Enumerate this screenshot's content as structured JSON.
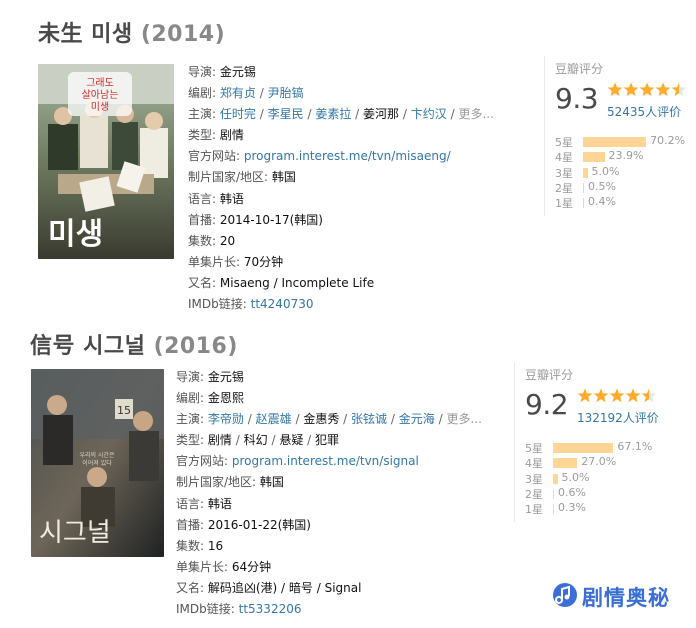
{
  "entries": [
    {
      "title": "未生 미생",
      "year": "(2014)",
      "poster": {
        "title_text": "미생",
        "tagline": "그래도 살아남는 미생"
      },
      "info": {
        "director_label": "导演:",
        "director": "金元锡",
        "writer_label": "编剧:",
        "writers": [
          "郑有贞",
          "尹胎镐"
        ],
        "cast_label": "主演:",
        "cast": [
          "任时完",
          "李星民",
          "姜素拉",
          "姜河那",
          "卞约汉"
        ],
        "cast_more": "更多...",
        "genre_label": "类型:",
        "genres": [
          "剧情"
        ],
        "website_label": "官方网站:",
        "website": "program.interest.me/tvn/misaeng/",
        "country_label": "制片国家/地区:",
        "country": "韩国",
        "language_label": "语言:",
        "language": "韩语",
        "premiere_label": "首播:",
        "premiere": "2014-10-17(韩国)",
        "episodes_label": "集数:",
        "episodes": "20",
        "runtime_label": "单集片长:",
        "runtime": "70分钟",
        "aka_label": "又名:",
        "aka": "Misaeng / Incomplete Life",
        "imdb_label": "IMDb链接:",
        "imdb": "tt4240730"
      },
      "rating": {
        "label": "豆瓣评分",
        "score": "9.3",
        "stars": 4.5,
        "count": "52435人评价",
        "distribution": [
          {
            "star": "5星",
            "percent": 70.2,
            "text": "70.2%"
          },
          {
            "star": "4星",
            "percent": 23.9,
            "text": "23.9%"
          },
          {
            "star": "3星",
            "percent": 5.0,
            "text": "5.0%"
          },
          {
            "star": "2星",
            "percent": 0.5,
            "text": "0.5%"
          },
          {
            "star": "1星",
            "percent": 0.4,
            "text": "0.4%"
          }
        ]
      }
    },
    {
      "title": "信号 시그널",
      "year": "(2016)",
      "poster": {
        "title_text": "시그널",
        "tagline": "우리의 시간은 이어져 있다"
      },
      "info": {
        "director_label": "导演:",
        "director": "金元锡",
        "writer_label": "编剧:",
        "writers": [
          "金恩熙"
        ],
        "cast_label": "主演:",
        "cast": [
          "李帝勋",
          "赵震雄",
          "金惠秀",
          "张铉诚",
          "金元海"
        ],
        "cast_more": "更多...",
        "genre_label": "类型:",
        "genres": [
          "剧情",
          "科幻",
          "悬疑",
          "犯罪"
        ],
        "website_label": "官方网站:",
        "website": "program.interest.me/tvn/signal",
        "country_label": "制片国家/地区:",
        "country": "韩国",
        "language_label": "语言:",
        "language": "韩语",
        "premiere_label": "首播:",
        "premiere": "2016-01-22(韩国)",
        "episodes_label": "集数:",
        "episodes": "16",
        "runtime_label": "单集片长:",
        "runtime": "64分钟",
        "aka_label": "又名:",
        "aka": "解码追凶(港) / 暗号 / Signal",
        "imdb_label": "IMDb链接:",
        "imdb": "tt5332206"
      },
      "rating": {
        "label": "豆瓣评分",
        "score": "9.2",
        "stars": 4.5,
        "count": "132192人评价",
        "distribution": [
          {
            "star": "5星",
            "percent": 67.1,
            "text": "67.1%"
          },
          {
            "star": "4星",
            "percent": 27.0,
            "text": "27.0%"
          },
          {
            "star": "3星",
            "percent": 5.0,
            "text": "5.0%"
          },
          {
            "star": "2星",
            "percent": 0.6,
            "text": "0.6%"
          },
          {
            "star": "1星",
            "percent": 0.3,
            "text": "0.3%"
          }
        ]
      }
    }
  ],
  "brand": {
    "text": "剧情奥秘",
    "icon": "music-note-icon",
    "color": "#3b6fd6"
  },
  "colors": {
    "link": "#37a",
    "star": "#ffac2d",
    "bar": "#ffd596",
    "muted": "#9b9b9b"
  }
}
